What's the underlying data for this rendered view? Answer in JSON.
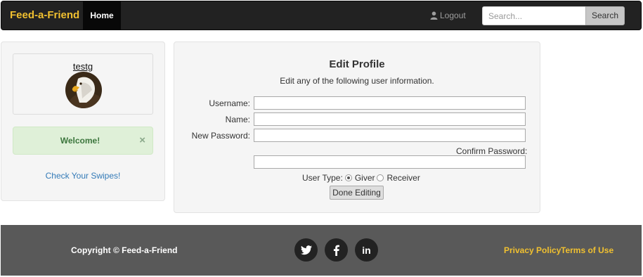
{
  "navbar": {
    "brand": "Feed-a-Friend",
    "home_label": "Home",
    "logout_label": "Logout",
    "logout_icon": "user-icon",
    "search_placeholder": "Search...",
    "search_button": "Search"
  },
  "sidebar": {
    "username": "testg",
    "avatar_icon": "eagle-avatar",
    "welcome_message": "Welcome!",
    "welcome_close": "×",
    "swipes_link": "Check Your Swipes!"
  },
  "edit_profile": {
    "title": "Edit Profile",
    "subtitle": "Edit any of the following user information.",
    "fields": {
      "username_label": "Username:",
      "name_label": "Name:",
      "new_password_label": "New Password:",
      "confirm_password_label": "Confirm Password:"
    },
    "user_type_label": "User Type:",
    "user_type_options": [
      "Giver",
      "Receiver"
    ],
    "user_type_selected": "Giver",
    "done_button": "Done Editing"
  },
  "footer": {
    "copyright": "Copyright © Feed-a-Friend",
    "social": [
      "twitter-icon",
      "facebook-icon",
      "linkedin-icon"
    ],
    "linkedin_text": "in",
    "privacy_link": "Privacy Policy",
    "terms_link": "Terms of Use"
  },
  "colors": {
    "brand_yellow": "#f0c030",
    "navbar_bg": "#222222",
    "footer_bg": "#595959",
    "alert_green_bg": "#dff0d8",
    "alert_green_text": "#3c763d",
    "link_blue": "#337ab7"
  }
}
